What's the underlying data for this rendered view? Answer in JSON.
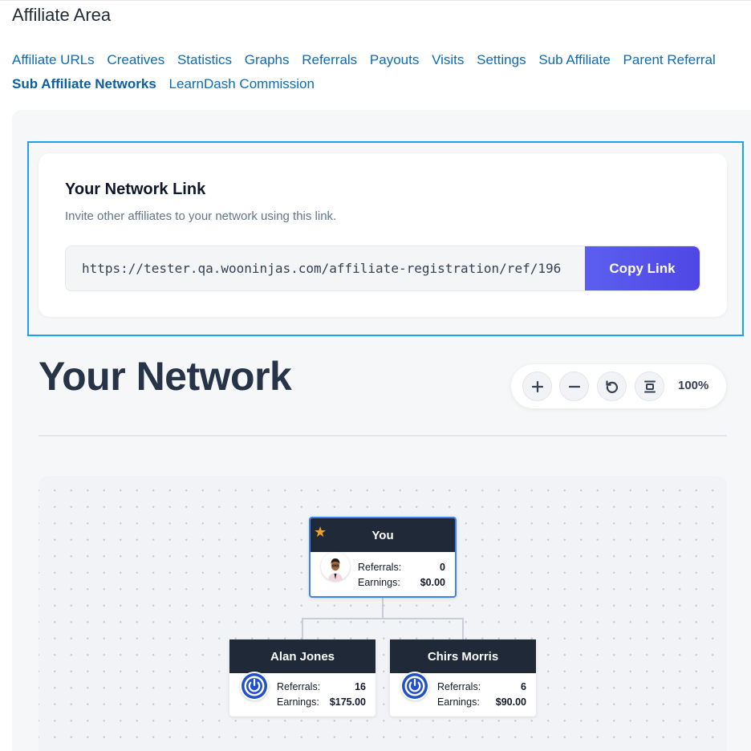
{
  "page": {
    "title": "Affiliate Area"
  },
  "nav": {
    "items": [
      {
        "label": "Affiliate URLs"
      },
      {
        "label": "Creatives"
      },
      {
        "label": "Statistics"
      },
      {
        "label": "Graphs"
      },
      {
        "label": "Referrals"
      },
      {
        "label": "Payouts"
      },
      {
        "label": "Visits"
      },
      {
        "label": "Settings"
      },
      {
        "label": "Sub Affiliate"
      },
      {
        "label": "Parent Referral"
      },
      {
        "label": "Sub Affiliate Networks",
        "active": true
      },
      {
        "label": "LearnDash Commission"
      }
    ]
  },
  "network_link": {
    "title": "Your Network Link",
    "subtitle": "Invite other affiliates to your network using this link.",
    "url": "https://tester.qa.wooninjas.com/affiliate-registration/ref/196",
    "copy_label": "Copy Link"
  },
  "network": {
    "title": "Your Network",
    "zoom": {
      "level": "100%",
      "icons": [
        "plus-icon",
        "minus-icon",
        "reset-icon",
        "fit-icon"
      ]
    },
    "root": {
      "name": "You",
      "badge_icon": "star-icon",
      "referrals_label": "Referrals:",
      "referrals": "0",
      "earnings_label": "Earnings:",
      "earnings": "$0.00"
    },
    "children": [
      {
        "name": "Alan Jones",
        "referrals_label": "Referrals:",
        "referrals": "16",
        "earnings_label": "Earnings:",
        "earnings": "$175.00"
      },
      {
        "name": "Chirs Morris",
        "referrals_label": "Referrals:",
        "referrals": "6",
        "earnings_label": "Earnings:",
        "earnings": "$90.00"
      }
    ]
  },
  "colors": {
    "link": "#0b6bb5",
    "accent": "#5046e5",
    "node_header": "#1f2937",
    "highlight": "#1aa3ea"
  }
}
